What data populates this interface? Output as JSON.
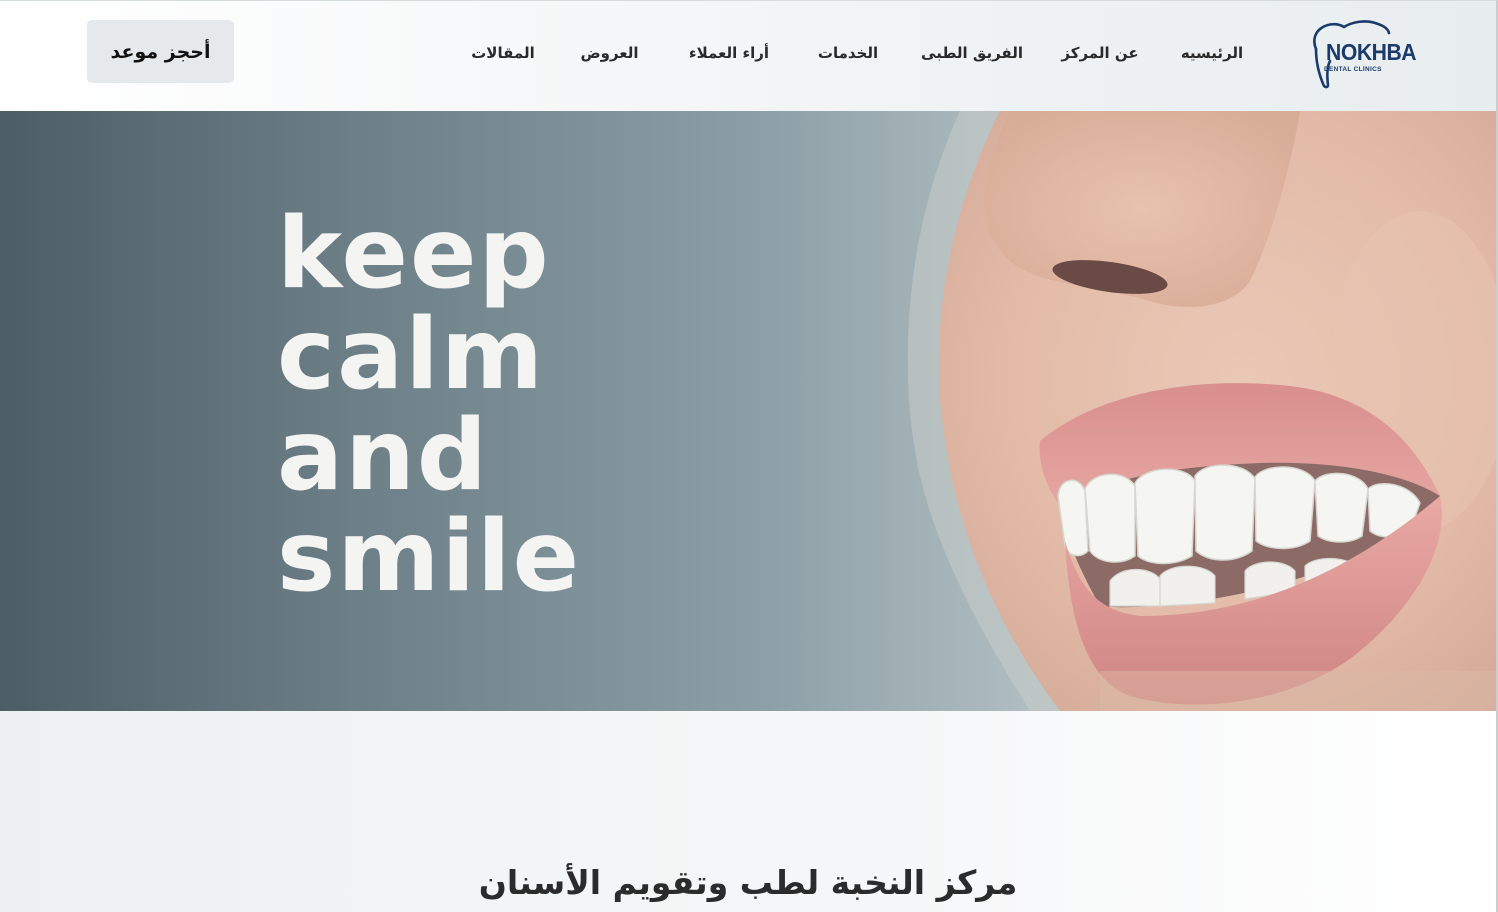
{
  "header": {
    "cta_label": "أحجز موعد",
    "nav": [
      "الرئيسيه",
      "عن المركز",
      "الفريق الطبى",
      "الخدمات",
      "أراء العملاء",
      "العروض",
      "المقالات"
    ],
    "logo": {
      "wordmark": "NOKHBA",
      "subtitle": "DENTAL CLINICS",
      "icon": "tooth-outline-icon",
      "color": "#1a3b6b"
    }
  },
  "hero": {
    "lines": [
      "keep",
      "calm",
      "and",
      "smile"
    ],
    "image": "smiling-woman-teeth-photo"
  },
  "section": {
    "title": "مركز النخبة لطب وتقويم الأسنان"
  }
}
